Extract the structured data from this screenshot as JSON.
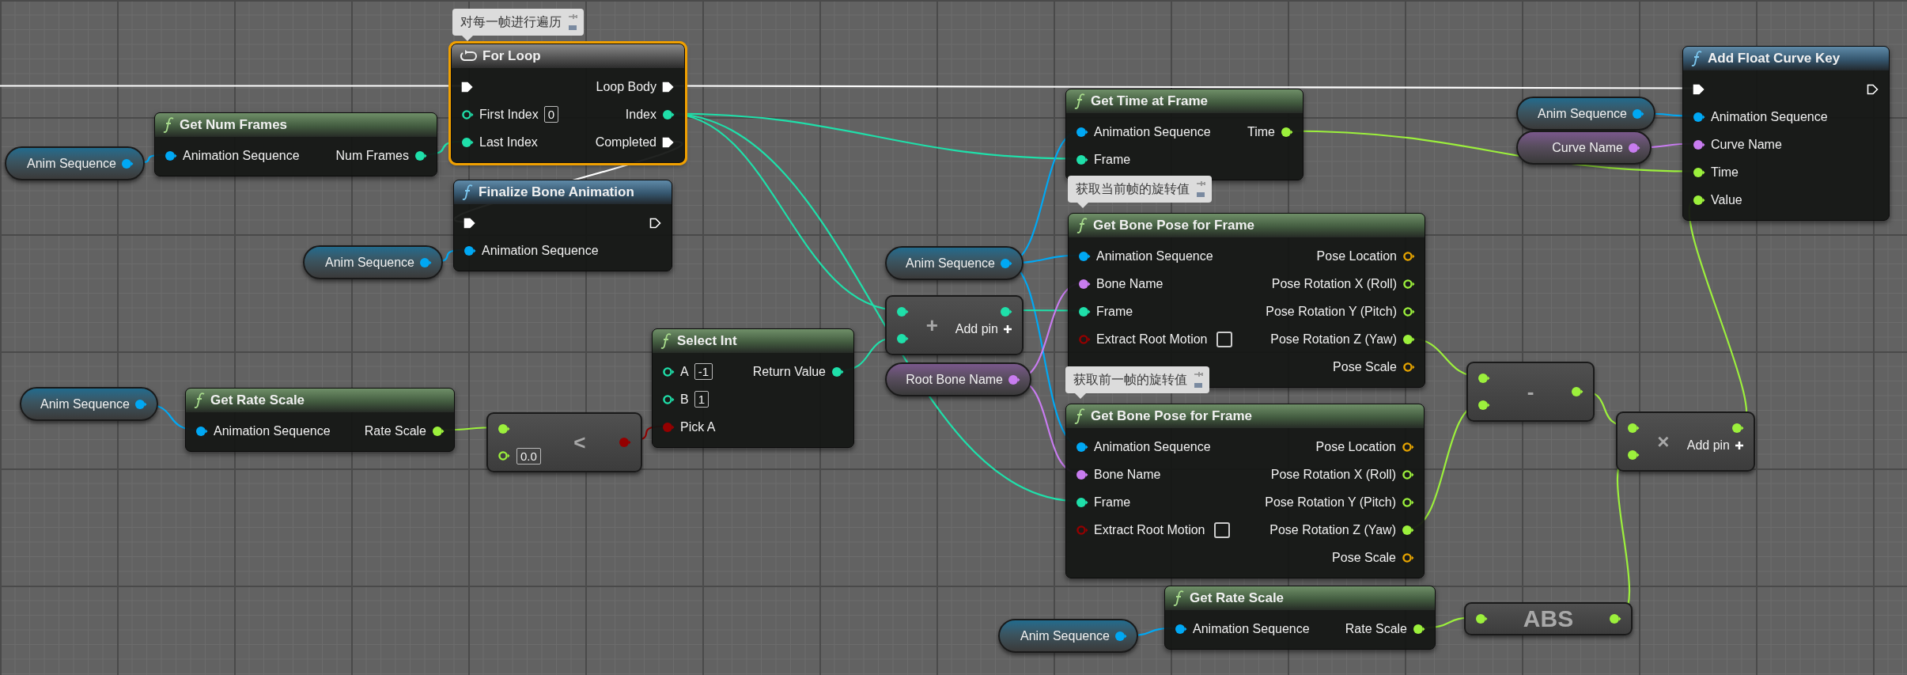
{
  "graph": {
    "nodes": [
      {
        "kind": "comment",
        "selected": false,
        "text": "对每一帧进行遍历"
      },
      {
        "kind": "macro",
        "selected": true,
        "title": "For Loop",
        "inputs": [
          {
            "kind": "exec",
            "connected": true
          },
          {
            "kind": "data",
            "color": "#1fe0aa",
            "label": "First Index",
            "default": "0",
            "connected": false
          },
          {
            "kind": "data",
            "color": "#1fe0aa",
            "label": "Last Index",
            "connected": true
          }
        ],
        "outputs": [
          {
            "kind": "exec",
            "label": "Loop Body",
            "connected": true
          },
          {
            "kind": "data",
            "color": "#1fe0aa",
            "label": "Index",
            "connected": true
          },
          {
            "kind": "exec",
            "label": "Completed",
            "connected": true
          }
        ]
      },
      {
        "kind": "pure_function",
        "selected": false,
        "title": "Get Num Frames",
        "inputs": [
          {
            "kind": "data",
            "color": "#00a8f4",
            "label": "Animation Sequence",
            "connected": true
          }
        ],
        "outputs": [
          {
            "kind": "data",
            "color": "#1fe0aa",
            "label": "Num Frames",
            "connected": true
          }
        ]
      },
      {
        "kind": "variable",
        "selected": false,
        "label": "Anim Sequence",
        "color": "#00a8f4"
      },
      {
        "kind": "function",
        "selected": false,
        "title": "Finalize Bone Animation",
        "inputs": [
          {
            "kind": "exec",
            "connected": true
          },
          {
            "kind": "data",
            "color": "#00a8f4",
            "label": "Animation Sequence",
            "connected": true
          }
        ],
        "outputs": [
          {
            "kind": "exec",
            "connected": false
          }
        ]
      },
      {
        "kind": "variable",
        "selected": false,
        "label": "Anim Sequence",
        "color": "#00a8f4"
      },
      {
        "kind": "pure_function",
        "selected": false,
        "title": "Get Time at Frame",
        "inputs": [
          {
            "kind": "data",
            "color": "#00a8f4",
            "label": "Animation Sequence",
            "connected": true
          },
          {
            "kind": "data",
            "color": "#1fe0aa",
            "label": "Frame",
            "connected": true
          }
        ],
        "outputs": [
          {
            "kind": "data",
            "color": "#9cf03c",
            "label": "Time",
            "connected": true
          }
        ]
      },
      {
        "kind": "comment",
        "selected": false,
        "text": "获取当前帧的旋转值"
      },
      {
        "kind": "pure_function",
        "selected": false,
        "title": "Get Bone Pose for Frame",
        "inputs": [
          {
            "kind": "data",
            "color": "#00a8f4",
            "label": "Animation Sequence",
            "connected": true
          },
          {
            "kind": "data",
            "color": "#c87cf0",
            "label": "Bone Name",
            "connected": true
          },
          {
            "kind": "data",
            "color": "#1fe0aa",
            "label": "Frame",
            "connected": true
          },
          {
            "kind": "data",
            "color": "#950000",
            "label": "Extract Root Motion",
            "connected": false,
            "checked": false
          }
        ],
        "outputs": [
          {
            "kind": "data",
            "color": "#e6a400",
            "label": "Pose Location",
            "connected": false
          },
          {
            "kind": "data",
            "color": "#9cf03c",
            "label": "Pose Rotation X (Roll)",
            "connected": false
          },
          {
            "kind": "data",
            "color": "#9cf03c",
            "label": "Pose Rotation Y (Pitch)",
            "connected": false
          },
          {
            "kind": "data",
            "color": "#9cf03c",
            "label": "Pose Rotation Z (Yaw)",
            "connected": true
          },
          {
            "kind": "data",
            "color": "#e6a400",
            "label": "Pose Scale",
            "connected": false
          }
        ]
      },
      {
        "kind": "variable",
        "selected": false,
        "label": "Anim Sequence",
        "color": "#00a8f4"
      },
      {
        "kind": "operator",
        "selected": false,
        "symbol": "+",
        "add_pin": "Add pin",
        "inputs": [
          {
            "kind": "data",
            "color": "#1fe0aa",
            "connected": true
          },
          {
            "kind": "data",
            "color": "#1fe0aa",
            "connected": true
          }
        ],
        "outputs": [
          {
            "kind": "data",
            "color": "#1fe0aa",
            "connected": true
          }
        ]
      },
      {
        "kind": "variable",
        "selected": false,
        "label": "Root Bone Name",
        "color": "#c87cf0"
      },
      {
        "kind": "comment",
        "selected": false,
        "text": "获取前一帧的旋转值"
      },
      {
        "kind": "pure_function",
        "selected": false,
        "title": "Get Bone Pose for Frame",
        "inputs": [
          {
            "kind": "data",
            "color": "#00a8f4",
            "label": "Animation Sequence",
            "connected": true
          },
          {
            "kind": "data",
            "color": "#c87cf0",
            "label": "Bone Name",
            "connected": true
          },
          {
            "kind": "data",
            "color": "#1fe0aa",
            "label": "Frame",
            "connected": true
          },
          {
            "kind": "data",
            "color": "#950000",
            "label": "Extract Root Motion",
            "connected": false,
            "checked": false
          }
        ],
        "outputs": [
          {
            "kind": "data",
            "color": "#e6a400",
            "label": "Pose Location",
            "connected": false
          },
          {
            "kind": "data",
            "color": "#9cf03c",
            "label": "Pose Rotation X (Roll)",
            "connected": false
          },
          {
            "kind": "data",
            "color": "#9cf03c",
            "label": "Pose Rotation Y (Pitch)",
            "connected": false
          },
          {
            "kind": "data",
            "color": "#9cf03c",
            "label": "Pose Rotation Z (Yaw)",
            "connected": true
          },
          {
            "kind": "data",
            "color": "#e6a400",
            "label": "Pose Scale",
            "connected": false
          }
        ]
      },
      {
        "kind": "pure_function",
        "selected": false,
        "title": "Select Int",
        "inputs": [
          {
            "kind": "data",
            "color": "#1fe0aa",
            "label": "A",
            "default": "-1",
            "connected": false
          },
          {
            "kind": "data",
            "color": "#1fe0aa",
            "label": "B",
            "default": "1",
            "connected": false
          },
          {
            "kind": "data",
            "color": "#950000",
            "label": "Pick A",
            "connected": true
          }
        ],
        "outputs": [
          {
            "kind": "data",
            "color": "#1fe0aa",
            "label": "Return Value",
            "connected": true
          }
        ]
      },
      {
        "kind": "variable",
        "selected": false,
        "label": "Anim Sequence",
        "color": "#00a8f4"
      },
      {
        "kind": "pure_function",
        "selected": false,
        "title": "Get Rate Scale",
        "inputs": [
          {
            "kind": "data",
            "color": "#00a8f4",
            "label": "Animation Sequence",
            "connected": true
          }
        ],
        "outputs": [
          {
            "kind": "data",
            "color": "#9cf03c",
            "label": "Rate Scale",
            "connected": true
          }
        ]
      },
      {
        "kind": "operator",
        "selected": false,
        "symbol": "<",
        "inputs": [
          {
            "kind": "data",
            "color": "#9cf03c",
            "connected": true
          },
          {
            "kind": "data",
            "color": "#9cf03c",
            "default": "0.0",
            "connected": false
          }
        ],
        "outputs": [
          {
            "kind": "data",
            "color": "#950000",
            "connected": true
          }
        ]
      },
      {
        "kind": "operator",
        "selected": false,
        "symbol": "-",
        "inputs": [
          {
            "kind": "data",
            "color": "#9cf03c",
            "connected": true
          },
          {
            "kind": "data",
            "color": "#9cf03c",
            "connected": true
          }
        ],
        "outputs": [
          {
            "kind": "data",
            "color": "#9cf03c",
            "connected": true
          }
        ]
      },
      {
        "kind": "operator",
        "selected": false,
        "symbol": "×",
        "add_pin": "Add pin",
        "inputs": [
          {
            "kind": "data",
            "color": "#9cf03c",
            "connected": true
          },
          {
            "kind": "data",
            "color": "#9cf03c",
            "connected": true
          }
        ],
        "outputs": [
          {
            "kind": "data",
            "color": "#9cf03c",
            "connected": true
          }
        ]
      },
      {
        "kind": "pure_function",
        "selected": false,
        "title": "Get Rate Scale",
        "inputs": [
          {
            "kind": "data",
            "color": "#00a8f4",
            "label": "Animation Sequence",
            "connected": true
          }
        ],
        "outputs": [
          {
            "kind": "data",
            "color": "#9cf03c",
            "label": "Rate Scale",
            "connected": true
          }
        ]
      },
      {
        "kind": "variable",
        "selected": false,
        "label": "Anim Sequence",
        "color": "#00a8f4"
      },
      {
        "kind": "operator",
        "selected": false,
        "symbol": "ABS",
        "inputs": [
          {
            "kind": "data",
            "color": "#9cf03c",
            "connected": true
          }
        ],
        "outputs": [
          {
            "kind": "data",
            "color": "#9cf03c",
            "connected": true
          }
        ]
      },
      {
        "kind": "function",
        "selected": false,
        "title": "Add Float Curve Key",
        "inputs": [
          {
            "kind": "exec",
            "connected": true
          },
          {
            "kind": "data",
            "color": "#00a8f4",
            "label": "Animation Sequence",
            "connected": true
          },
          {
            "kind": "data",
            "color": "#c87cf0",
            "label": "Curve Name",
            "connected": true
          },
          {
            "kind": "data",
            "color": "#9cf03c",
            "label": "Time",
            "connected": true
          },
          {
            "kind": "data",
            "color": "#9cf03c",
            "label": "Value",
            "connected": true
          }
        ],
        "outputs": [
          {
            "kind": "exec",
            "connected": false
          }
        ]
      },
      {
        "kind": "variable",
        "selected": false,
        "label": "Anim Sequence",
        "color": "#00a8f4"
      },
      {
        "kind": "variable",
        "selected": false,
        "label": "Curve Name",
        "color": "#c87cf0"
      }
    ]
  }
}
